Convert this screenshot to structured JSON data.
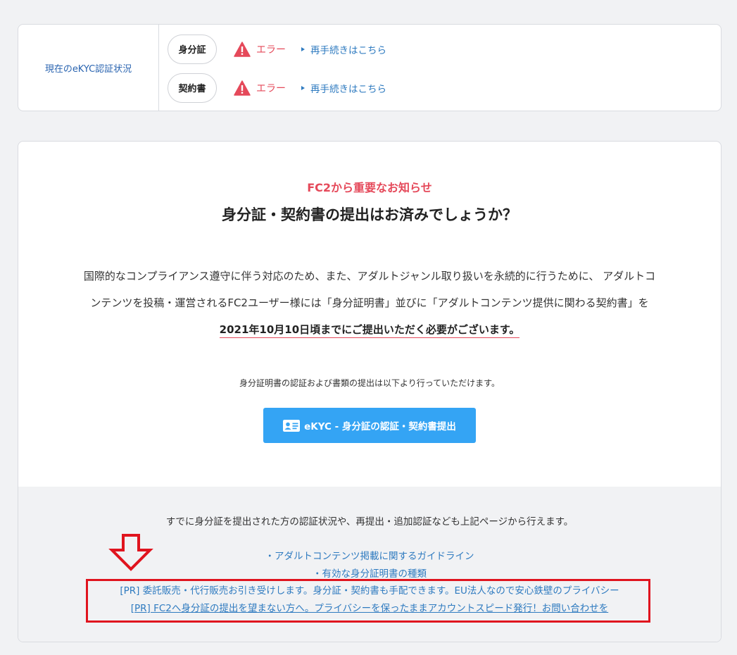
{
  "status": {
    "label": "現在のeKYC認証状況",
    "rows": [
      {
        "doc": "身分証",
        "status": "エラー",
        "link": "再手続きはこちら"
      },
      {
        "doc": "契約書",
        "status": "エラー",
        "link": "再手続きはこちら"
      }
    ],
    "error_color": "#e5495a"
  },
  "notice": {
    "subtitle": "FC2から重要なお知らせ",
    "title": "身分証・契約書の提出はお済みでしょうか？",
    "body_line1": "国際的なコンプライアンス遵守に伴う対応のため、また、アダルトジャンル取り扱いを永続的に行うために、 アダルトコ",
    "body_line2": "ンテンツを投稿・運営されるFC2ユーザー様には「身分証明書」並びに「アダルトコンテンツ提供に関わる契約書」を",
    "deadline": "2021年10月10日頃までにご提出いただく必要がございます。",
    "hint": "身分証明書の認証および書類の提出は以下より行っていただけます。",
    "button_label": "eKYC - 身分証の認証・契約書提出",
    "button_color": "#34a4f4"
  },
  "footer": {
    "note": "すでに身分証を提出された方の認証状況や、再提出・追加認証なども上記ページから行えます。",
    "link_guideline": "・アダルトコンテンツ掲載に関するガイドライン",
    "link_id_types": "・有効な身分証明書の種類",
    "pr1": "[PR] 委託販売・代行販売お引き受けします。身分証・契約書も手配できます。EU法人なので安心鉄壁のプライバシー",
    "pr2": "[PR] FC2へ身分証の提出を望まない方へ。プライバシーを保ったままアカウントスピード発行！お問い合わせを"
  },
  "icons": {
    "error": "warning-triangle-icon",
    "link_bullet": "triangle-right-icon",
    "button": "id-card-icon",
    "annotation": "down-arrow-icon"
  }
}
